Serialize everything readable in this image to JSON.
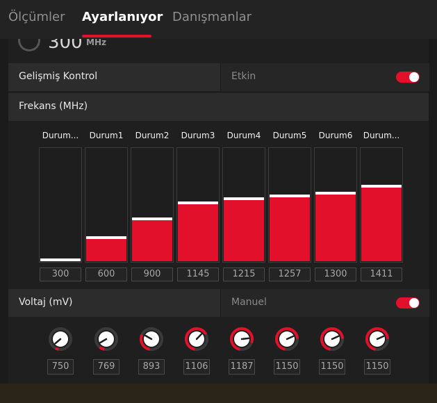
{
  "tabs": [
    {
      "label": "Ölçümler"
    },
    {
      "label": "Ayarlanıyor"
    },
    {
      "label": "Danışmanlar"
    }
  ],
  "previous": {
    "value": "300",
    "unit": "MHz"
  },
  "advanced": {
    "label": "Gelişmiş Kontrol",
    "mode": "Etkin",
    "toggle_on": true
  },
  "frequency": {
    "label": "Frekans (MHz)",
    "max": 1411,
    "states": [
      {
        "label": "Durum...",
        "value": "300"
      },
      {
        "label": "Durum1",
        "value": "600"
      },
      {
        "label": "Durum2",
        "value": "900"
      },
      {
        "label": "Durum3",
        "value": "1145"
      },
      {
        "label": "Durum4",
        "value": "1215"
      },
      {
        "label": "Durum5",
        "value": "1257"
      },
      {
        "label": "Durum6",
        "value": "1300"
      },
      {
        "label": "Durum...",
        "value": "1411"
      }
    ]
  },
  "voltage": {
    "label": "Voltaj (mV)",
    "mode": "Manuel",
    "toggle_on": true,
    "min": 750,
    "max": 1200,
    "values": [
      "750",
      "769",
      "893",
      "1106",
      "1187",
      "1150",
      "1150",
      "1150"
    ]
  },
  "colors": {
    "accent": "#e3102b",
    "panel": "#2c2c2c",
    "background": "#1b1b1b"
  }
}
